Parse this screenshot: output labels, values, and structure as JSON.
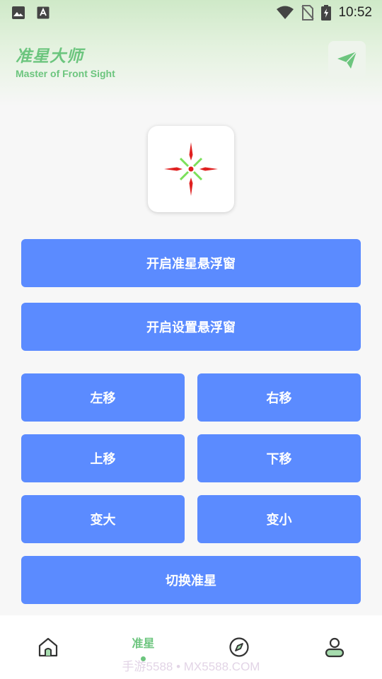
{
  "status_bar": {
    "time": "10:52",
    "icons_left": [
      "image-icon",
      "font-icon"
    ],
    "icons_right": [
      "wifi-icon",
      "no-sim-icon",
      "battery-charging-icon"
    ]
  },
  "header": {
    "title": "准星大师",
    "subtitle": "Master of Front Sight",
    "action_icon": "send-icon"
  },
  "colors": {
    "accent_green": "#6cc57e",
    "button_blue": "#5b8bff",
    "background": "#f7f7f7"
  },
  "buttons": {
    "open_crosshair_float": "开启准星悬浮窗",
    "open_settings_float": "开启设置悬浮窗",
    "move_left": "左移",
    "move_right": "右移",
    "move_up": "上移",
    "move_down": "下移",
    "enlarge": "变大",
    "shrink": "变小",
    "switch_crosshair": "切换准星"
  },
  "bottom_nav": {
    "items": [
      {
        "icon": "home-icon",
        "label": ""
      },
      {
        "icon": "",
        "label": "准星",
        "active": true
      },
      {
        "icon": "compass-icon",
        "label": ""
      },
      {
        "icon": "profile-icon",
        "label": ""
      }
    ]
  },
  "watermark": "手游5588 • MX5588.COM"
}
